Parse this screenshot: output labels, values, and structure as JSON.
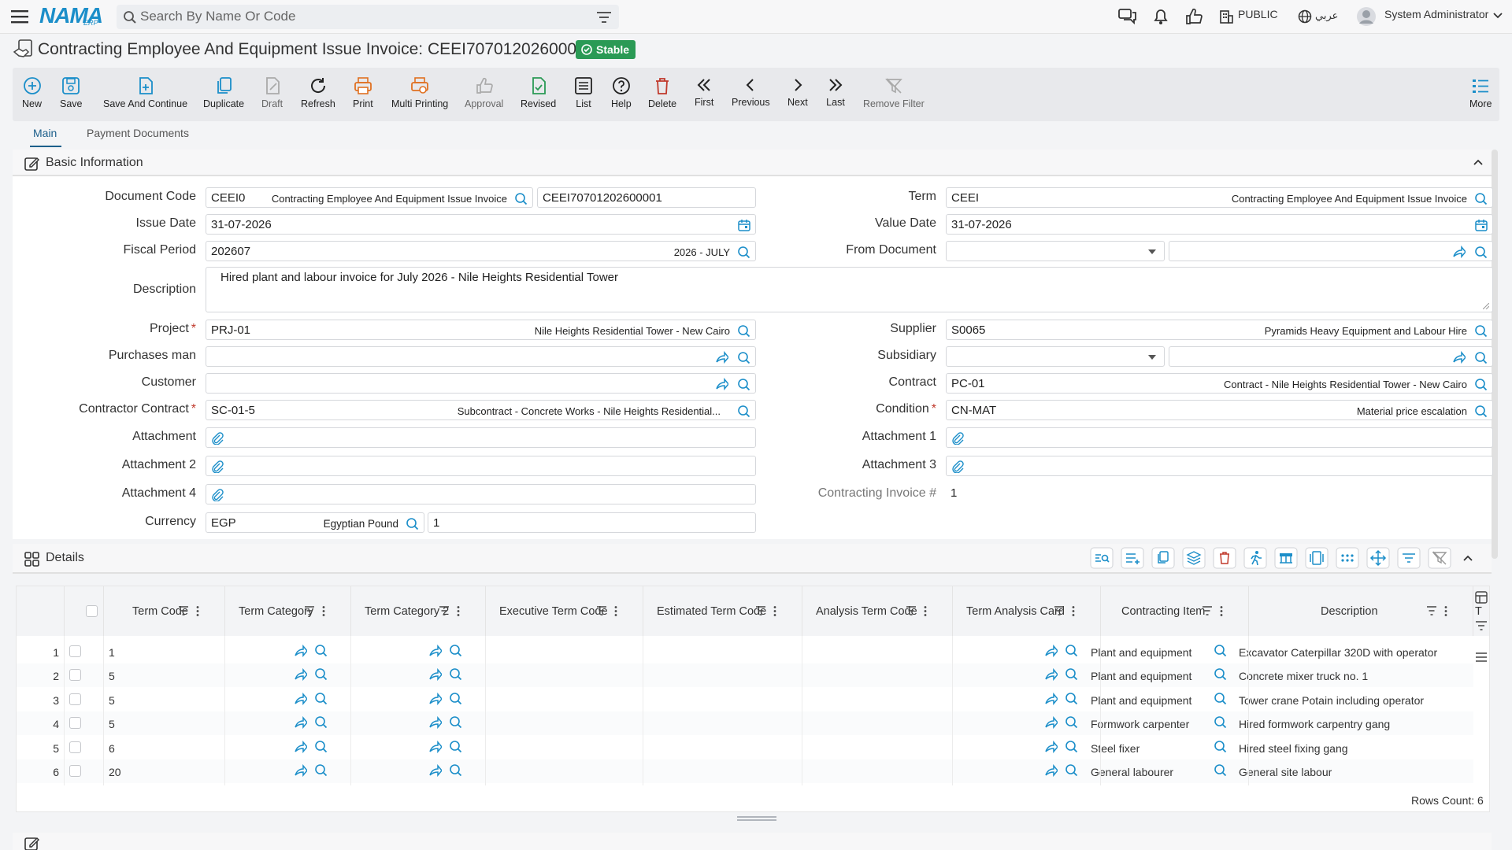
{
  "app": {
    "logo_text": "NAMA",
    "logo_sub": "ERP"
  },
  "search": {
    "placeholder": "Search By Name Or Code"
  },
  "topbar": {
    "public_label": "PUBLIC",
    "lang_label": "عربي",
    "user_name": "System Administrator"
  },
  "page": {
    "title": "Contracting Employee And Equipment Issue Invoice: CEEI70701202600001",
    "status": "Stable"
  },
  "toolbar": {
    "new": "New",
    "save": "Save",
    "save_continue": "Save And Continue",
    "duplicate": "Duplicate",
    "draft": "Draft",
    "refresh": "Refresh",
    "print": "Print",
    "multi_printing": "Multi Printing",
    "approval": "Approval",
    "revised": "Revised",
    "list": "List",
    "help": "Help",
    "delete": "Delete",
    "first": "First",
    "previous": "Previous",
    "next": "Next",
    "last": "Last",
    "remove_filter": "Remove Filter",
    "more": "More"
  },
  "tabs": {
    "main": "Main",
    "payment": "Payment Documents"
  },
  "basic": {
    "title": "Basic Information",
    "document_code": {
      "label": "Document Code",
      "code": "CEEI0",
      "name": "Contracting Employee And Equipment Issue Invoice",
      "number": "CEEI70701202600001"
    },
    "term": {
      "label": "Term",
      "code": "CEEI",
      "name": "Contracting Employee And Equipment Issue Invoice"
    },
    "issue_date": {
      "label": "Issue Date",
      "value": "31-07-2026"
    },
    "value_date": {
      "label": "Value Date",
      "value": "31-07-2026"
    },
    "fiscal_period": {
      "label": "Fiscal Period",
      "value": "202607",
      "name": "2026 - JULY"
    },
    "from_document": {
      "label": "From Document"
    },
    "description": {
      "label": "Description",
      "value": "Hired plant and labour invoice for July 2026 - Nile Heights Residential Tower"
    },
    "project": {
      "label": "Project",
      "code": "PRJ-01",
      "name": "Nile Heights Residential Tower - New Cairo"
    },
    "supplier": {
      "label": "Supplier",
      "code": "S0065",
      "name": "Pyramids Heavy Equipment and Labour Hire"
    },
    "purchases_man": {
      "label": "Purchases man"
    },
    "subsidiary": {
      "label": "Subsidiary"
    },
    "customer": {
      "label": "Customer"
    },
    "contract": {
      "label": "Contract",
      "code": "PC-01",
      "name": "Contract - Nile Heights Residential Tower - New Cairo"
    },
    "contractor_contract": {
      "label": "Contractor Contract",
      "code": "SC-01-5",
      "name": "Subcontract - Concrete Works - Nile Heights Residential..."
    },
    "condition": {
      "label": "Condition",
      "code": "CN-MAT",
      "name": "Material price escalation"
    },
    "attachment": {
      "label": "Attachment"
    },
    "attachment1": {
      "label": "Attachment 1"
    },
    "attachment2": {
      "label": "Attachment 2"
    },
    "attachment3": {
      "label": "Attachment 3"
    },
    "attachment4": {
      "label": "Attachment 4"
    },
    "contracting_invoice": {
      "label": "Contracting Invoice #",
      "value": "1"
    },
    "currency": {
      "label": "Currency",
      "code": "EGP",
      "name": "Egyptian Pound",
      "rate": "1"
    }
  },
  "details": {
    "title": "Details",
    "columns": [
      "Term Code",
      "Term Category",
      "Term Category 2",
      "Executive Term Code",
      "Estimated Term Code",
      "Analysis Term Code",
      "Term Analysis Card",
      "Contracting Item",
      "Description",
      "T"
    ],
    "rows": [
      {
        "n": "1",
        "term_code": "1",
        "item": "Plant and equipment",
        "desc": "Excavator Caterpillar 320D with operator"
      },
      {
        "n": "2",
        "term_code": "5",
        "item": "Plant and equipment",
        "desc": "Concrete mixer truck no. 1"
      },
      {
        "n": "3",
        "term_code": "5",
        "item": "Plant and equipment",
        "desc": "Tower crane Potain including operator"
      },
      {
        "n": "4",
        "term_code": "5",
        "item": "Formwork carpenter",
        "desc": "Hired formwork carpentry gang"
      },
      {
        "n": "5",
        "term_code": "6",
        "item": "Steel fixer",
        "desc": "Hired steel fixing gang"
      },
      {
        "n": "6",
        "term_code": "20",
        "item": "General labourer",
        "desc": "General site labour"
      }
    ],
    "rows_count": "Rows Count: 6"
  },
  "colors": {
    "accent": "#1b8ec9",
    "primary_text": "#1b5e8a",
    "badge": "#2a9a55",
    "danger": "#c0392b",
    "orange": "#e07020"
  }
}
